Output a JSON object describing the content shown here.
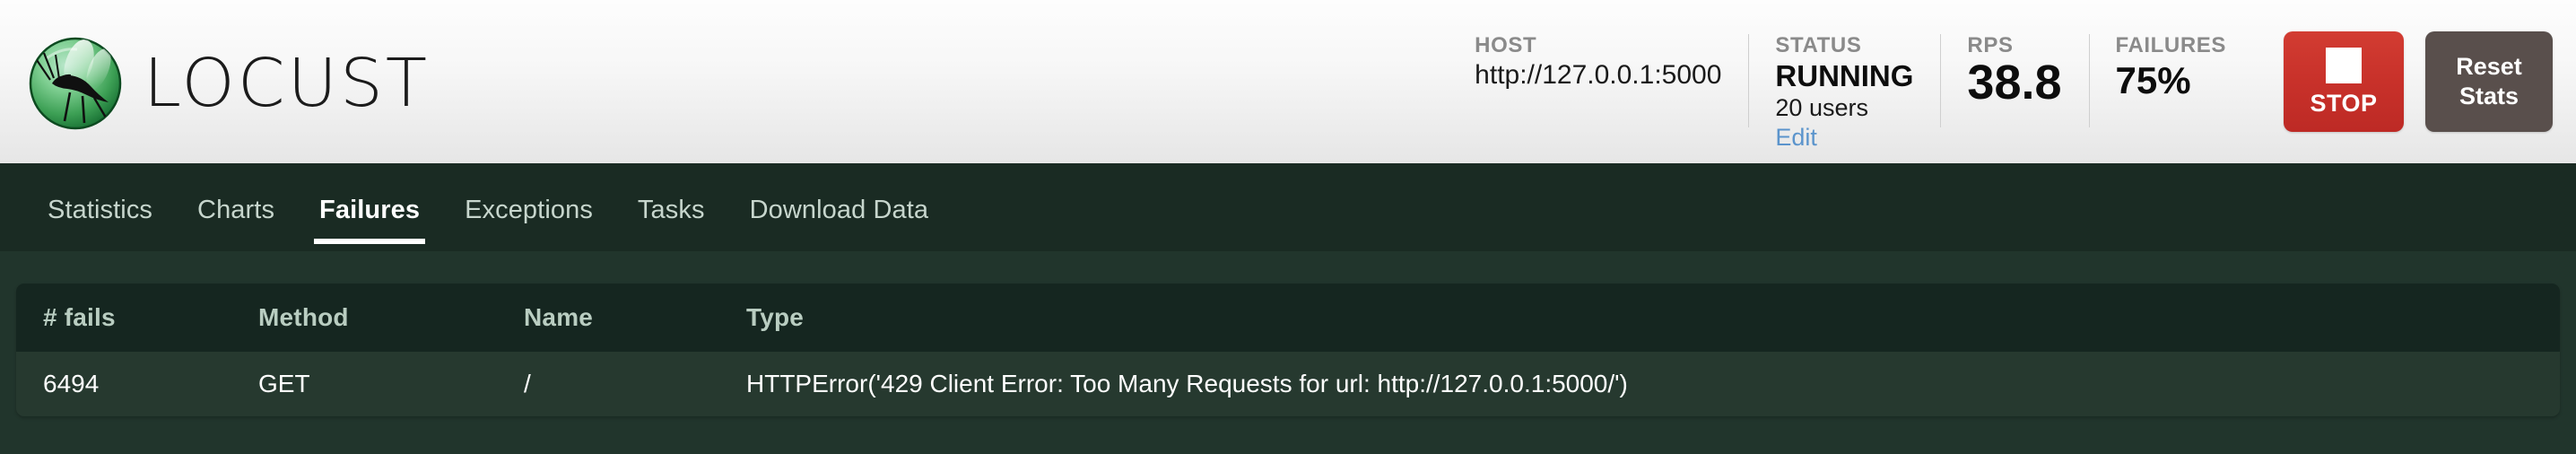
{
  "brand": {
    "wordmark": "LOCUST",
    "logo_icon": "locust-logo-icon"
  },
  "header": {
    "stats": [
      {
        "label": "HOST",
        "value": "http://127.0.0.1:5000"
      },
      {
        "label": "STATUS",
        "value": "RUNNING",
        "sub": "20 users",
        "link": "Edit"
      },
      {
        "label": "RPS",
        "value": "38.8"
      },
      {
        "label": "FAILURES",
        "value": "75%"
      }
    ],
    "buttons": {
      "stop_label": "STOP",
      "stop_icon": "stop-square-icon",
      "reset_label": "Reset\nStats"
    },
    "colors": {
      "stop_red": "#c8312a",
      "reset_gray": "#594f4c",
      "link_blue": "#5b94cc",
      "header_bg": "#ededed"
    }
  },
  "nav": {
    "tabs": [
      {
        "label": "Statistics",
        "active": false
      },
      {
        "label": "Charts",
        "active": false
      },
      {
        "label": "Failures",
        "active": true
      },
      {
        "label": "Exceptions",
        "active": false
      },
      {
        "label": "Tasks",
        "active": false
      },
      {
        "label": "Download Data",
        "active": false
      }
    ],
    "colors": {
      "bar_bg": "#1a2b23",
      "active_text": "#ffffff",
      "text": "#c7d6cd"
    }
  },
  "failures_table": {
    "columns": [
      "# fails",
      "Method",
      "Name",
      "Type"
    ],
    "rows": [
      {
        "fails": "6494",
        "method": "GET",
        "name": "/",
        "type": "HTTPError('429 Client Error: Too Many Requests for url: http://127.0.0.1:5000/')"
      }
    ],
    "colors": {
      "head_bg": "#152620",
      "row_bg": "#26392f",
      "page_bg": "#21352c"
    }
  }
}
